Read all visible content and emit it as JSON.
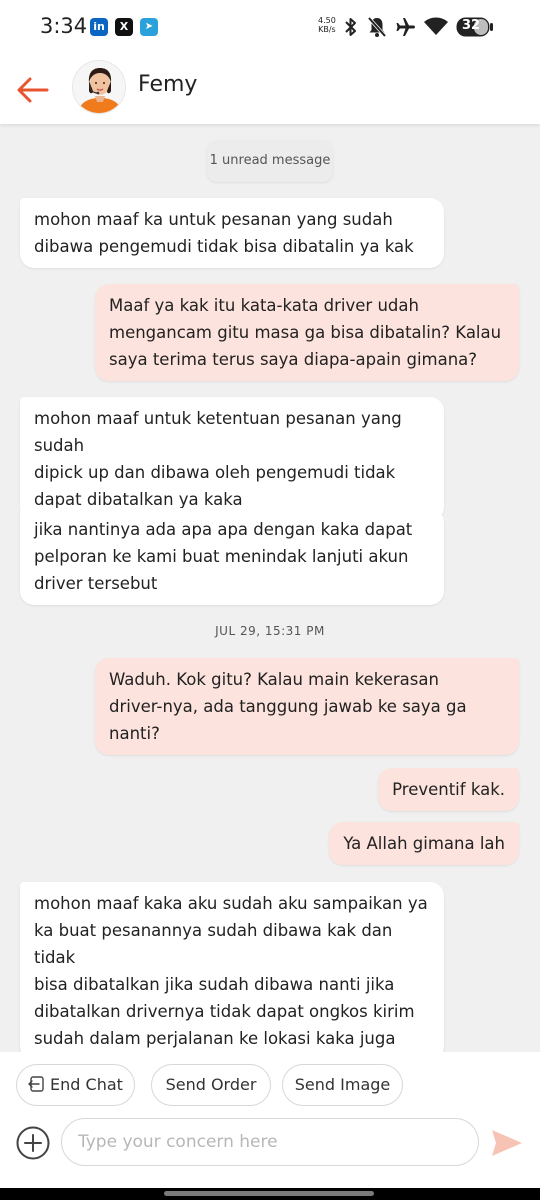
{
  "status_bar": {
    "time": "3:34",
    "apps": [
      {
        "name": "linkedin-icon",
        "glyph": "in",
        "color": "#0a66c2"
      },
      {
        "name": "x-icon",
        "glyph": "X",
        "color": "#111111"
      },
      {
        "name": "telegram-icon",
        "glyph": "➤",
        "color": "#2aa1da"
      }
    ],
    "net_speed_value": "4.50",
    "net_speed_unit": "KB/s",
    "battery": "32"
  },
  "header": {
    "contact_name": "Femy"
  },
  "chat": {
    "unread_label": "1 unread message",
    "date_separator": "JUL 29, 15:31 PM",
    "messages": [
      {
        "dir": "in",
        "text": "mohon maaf ka untuk pesanan yang sudah\ndibawa pengemudi tidak bisa dibatalin ya kak"
      },
      {
        "dir": "out",
        "text": "Maaf ya kak itu kata-kata driver udah\nmengancam gitu masa ga bisa dibatalin? Kalau\nsaya terima terus saya diapa-apain gimana?"
      },
      {
        "dir": "in",
        "text": "mohon maaf untuk ketentuan pesanan yang sudah\ndipick up dan dibawa oleh pengemudi tidak\ndapat dibatalkan ya kaka"
      },
      {
        "dir": "in",
        "text": "jika nantinya ada apa apa dengan kaka dapat\npelporan ke kami buat menindak lanjuti akun\ndriver tersebut"
      },
      {
        "dir": "out",
        "text": "Waduh. Kok gitu? Kalau main kekerasan\ndriver-nya, ada tanggung jawab ke saya ga\nnanti?"
      },
      {
        "dir": "out",
        "text": "Preventif kak."
      },
      {
        "dir": "out",
        "text": "Ya Allah gimana lah"
      },
      {
        "dir": "in",
        "text": "mohon maaf kaka aku sudah aku sampaikan ya\nka buat pesanannya sudah dibawa kak dan tidak\nbisa dibatalkan jika sudah dibawa nanti jika\ndibatalkan drivernya tidak dapat ongkos kirim\nsudah dalam perjalanan ke lokasi kaka juga"
      }
    ]
  },
  "actions": {
    "end_chat": "End Chat",
    "send_order": "Send Order",
    "send_image": "Send Image"
  },
  "composer": {
    "placeholder": "Type your concern here"
  },
  "colors": {
    "accent": "#e8542e",
    "outgoing_bubble": "#fde3dd",
    "incoming_bubble": "#ffffff",
    "send_disabled": "#f7c3b5"
  }
}
